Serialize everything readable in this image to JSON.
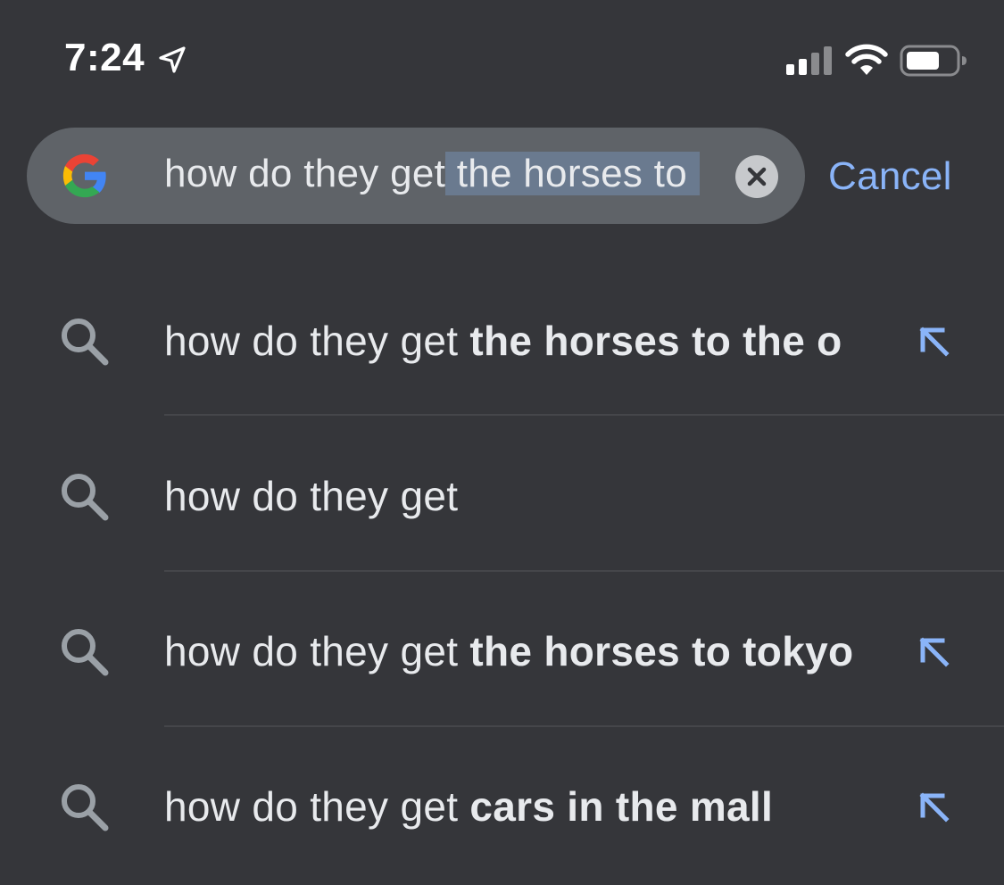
{
  "status_bar": {
    "time": "7:24",
    "icons": [
      "location-arrow-icon",
      "cellular-signal-icon",
      "wifi-icon",
      "battery-icon"
    ]
  },
  "search": {
    "query_plain": "how do they get",
    "query_selected": " the horses to",
    "cancel_label": "Cancel",
    "icons": [
      "google-logo",
      "clear-icon"
    ]
  },
  "colors": {
    "background": "#35363a",
    "search_field": "#5f6368",
    "accent": "#8ab4f8",
    "text": "#e8eaed",
    "selection": "#6a7a8f"
  },
  "suggestions": [
    {
      "prefix": "how do they get ",
      "bold": "the horses to the o",
      "has_fill_arrow": true
    },
    {
      "prefix": "how do they get",
      "bold": "",
      "has_fill_arrow": false
    },
    {
      "prefix": "how do they get ",
      "bold": "the horses to tokyo",
      "has_fill_arrow": true
    },
    {
      "prefix": "how do they get ",
      "bold": "cars in the mall",
      "has_fill_arrow": true
    }
  ]
}
